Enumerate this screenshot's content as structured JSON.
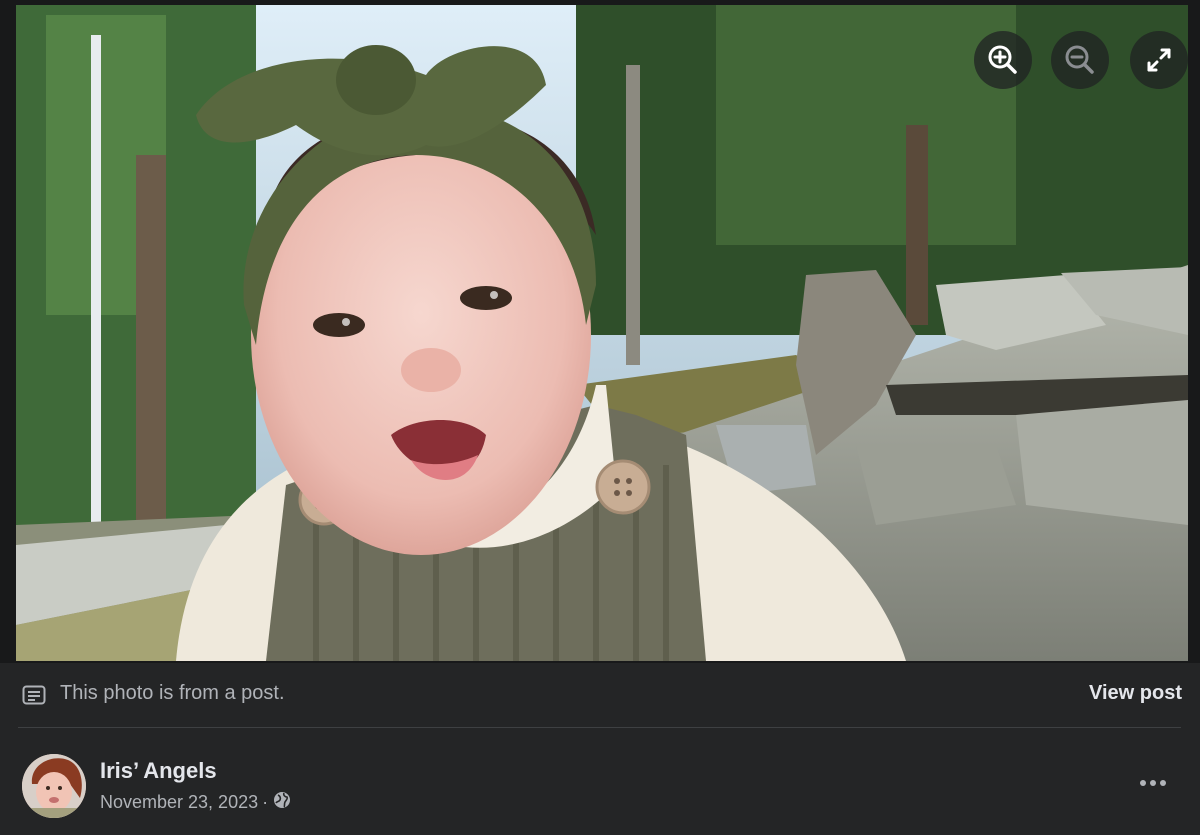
{
  "photo": {
    "description_icon": "photo",
    "controls": {
      "zoom_in_icon": "zoom-in-icon",
      "zoom_out_icon": "zoom-out-icon",
      "expand_icon": "expand-icon"
    }
  },
  "post_bar": {
    "note": "This photo is from a post.",
    "view_post_label": "View post",
    "note_icon": "post-text-icon"
  },
  "author": {
    "name": "Iris’ Angels",
    "date": "November 23, 2023",
    "separator": "·",
    "audience_icon": "globe-icon",
    "more_icon": "more-options-icon"
  },
  "colors": {
    "background": "#242526",
    "text_primary": "#e4e6eb",
    "text_secondary": "#b0b3b8",
    "divider": "#3e4042"
  }
}
